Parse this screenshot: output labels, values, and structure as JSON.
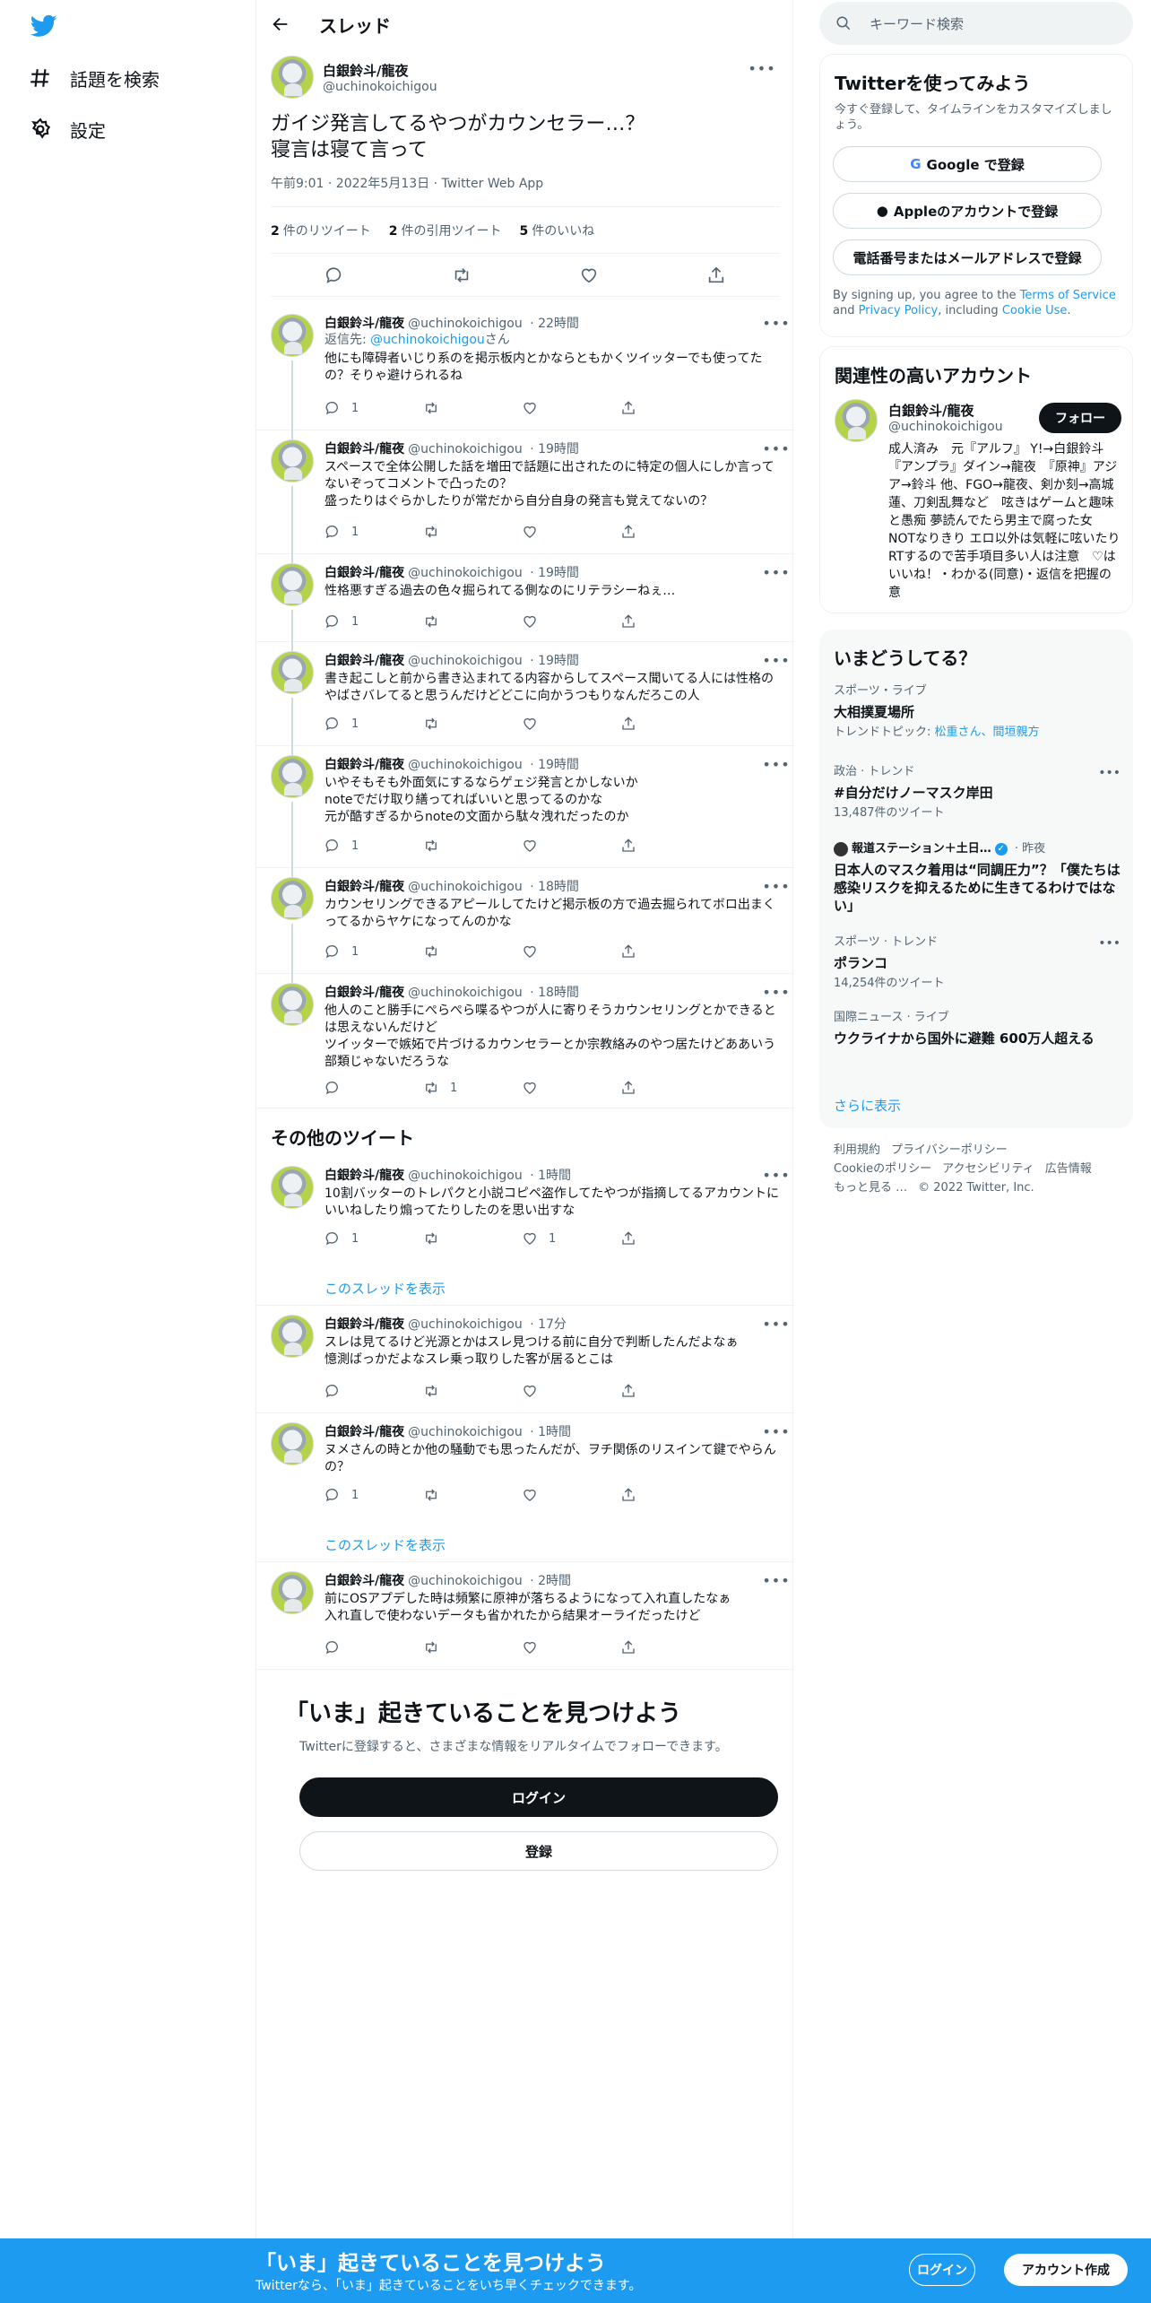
{
  "nav": {
    "explore_label": "話題を検索",
    "settings_label": "設定"
  },
  "header": {
    "title": "スレッド"
  },
  "main_tweet": {
    "name": "白銀鈴斗/龍夜",
    "handle": "@uchinokoichigou",
    "text": "ガイジ発言してるやつがカウンセラー…？\n寝言は寝て言って",
    "timestamp": "午前9:01 · 2022年5月13日 · Twitter Web App",
    "retweets_count": "2",
    "retweets_label": "件のリツイート",
    "quotes_count": "2",
    "quotes_label": "件の引用ツイート",
    "likes_count": "5",
    "likes_label": "件のいいね"
  },
  "replies": [
    {
      "name": "白銀鈴斗/龍夜",
      "handle": "@uchinokoichigou",
      "time": "· 22時間",
      "reply_prefix": "返信先: ",
      "reply_handle": "@uchinokoichigou",
      "reply_suffix": "さん",
      "text": "他にも障碍者いじり系のを掲示板内とかならともかくツイッターでも使ってたの？そりゃ避けられるね",
      "reply_count": "1",
      "rt_count": "",
      "like_count": ""
    },
    {
      "name": "白銀鈴斗/龍夜",
      "handle": "@uchinokoichigou",
      "time": "· 19時間",
      "text": "スペースで全体公開した話を増田で話題に出されたのに特定の個人にしか言ってないぞってコメントで凸ったの？\n盛ったりはぐらかしたりが常だから自分自身の発言も覚えてないの？",
      "reply_count": "1",
      "rt_count": "",
      "like_count": ""
    },
    {
      "name": "白銀鈴斗/龍夜",
      "handle": "@uchinokoichigou",
      "time": "· 19時間",
      "text": "性格悪すぎる過去の色々掘られてる側なのにリテラシーねぇ…",
      "reply_count": "1",
      "rt_count": "",
      "like_count": ""
    },
    {
      "name": "白銀鈴斗/龍夜",
      "handle": "@uchinokoichigou",
      "time": "· 19時間",
      "text": "書き起こしと前から書き込まれてる内容からしてスペース聞いてる人には性格のやばさバレてると思うんだけどどこに向かうつもりなんだろこの人",
      "reply_count": "1",
      "rt_count": "",
      "like_count": ""
    },
    {
      "name": "白銀鈴斗/龍夜",
      "handle": "@uchinokoichigou",
      "time": "· 19時間",
      "text": "いやそもそも外面気にするならゲェジ発言とかしないか\nnoteでだけ取り繕ってればいいと思ってるのかな\n元が酷すぎるからnoteの文面から駄々洩れだったのか",
      "reply_count": "1",
      "rt_count": "",
      "like_count": ""
    },
    {
      "name": "白銀鈴斗/龍夜",
      "handle": "@uchinokoichigou",
      "time": "· 18時間",
      "text": "カウンセリングできるアピールしてたけど掲示板の方で過去掘られてボロ出まくってるからヤケになってんのかな",
      "reply_count": "1",
      "rt_count": "",
      "like_count": ""
    },
    {
      "name": "白銀鈴斗/龍夜",
      "handle": "@uchinokoichigou",
      "time": "· 18時間",
      "text": "他人のこと勝手にぺらぺら喋るやつが人に寄りそうカウンセリングとかできるとは思えないんだけど\nツイッターで嫉妬で片づけるカウンセラーとか宗教絡みのやつ居たけどああいう部類じゃないだろうな",
      "reply_count": "",
      "rt_count": "1",
      "like_count": ""
    }
  ],
  "other_tweets_title": "その他のツイート",
  "other_tweets": [
    {
      "name": "白銀鈴斗/龍夜",
      "handle": "@uchinokoichigou",
      "time": "· 1時間",
      "text": "10割バッターのトレパクと小説コピペ盗作してたやつが指摘してるアカウントにいいねしたり煽ってたりしたのを思い出すな",
      "reply_count": "1",
      "rt_count": "",
      "like_count": "1",
      "show_thread": "このスレッドを表示"
    },
    {
      "name": "白銀鈴斗/龍夜",
      "handle": "@uchinokoichigou",
      "time": "· 17分",
      "text": "スレは見てるけど光源とかはスレ見つける前に自分で判断したんだよなぁ\n憶測ばっかだよなスレ乗っ取りした客が居るとこは",
      "reply_count": "",
      "rt_count": "",
      "like_count": ""
    },
    {
      "name": "白銀鈴斗/龍夜",
      "handle": "@uchinokoichigou",
      "time": "· 1時間",
      "text": "ヌメさんの時とか他の騒動でも思ったんだが、ヲチ関係のリスインて鍵でやらんの？",
      "reply_count": "1",
      "rt_count": "",
      "like_count": "",
      "show_thread": "このスレッドを表示"
    },
    {
      "name": "白銀鈴斗/龍夜",
      "handle": "@uchinokoichigou",
      "time": "· 2時間",
      "text": "前にOSアプデした時は頻繁に原神が落ちるようになって入れ直したなぁ\n入れ直しで使わないデータも省かれたから結果オーライだったけど",
      "reply_count": "",
      "rt_count": "",
      "like_count": ""
    }
  ],
  "cta": {
    "title": "「いま」起きていることを見つけよう",
    "subtitle": "Twitterに登録すると、さまざまな情報をリアルタイムでフォローできます。",
    "login_label": "ログイン",
    "signup_label": "登録"
  },
  "search": {
    "placeholder": "キーワード検索"
  },
  "signup_card": {
    "title": "Twitterを使ってみよう",
    "subtitle": "今すぐ登録して、タイムラインをカスタマイズしましょう。",
    "google_label": "Google で登録",
    "apple_label": "Appleのアカウントで登録",
    "phone_label": "電話番号またはメールアドレスで登録",
    "terms_prefix": "By signing up, you agree to the ",
    "terms_link": "Terms of Service",
    "terms_and": " and ",
    "privacy_link": "Privacy Policy",
    "terms_including": ", including ",
    "cookie_link": "Cookie Use",
    "terms_end": "."
  },
  "relevant": {
    "title": "関連性の高いアカウント",
    "name": "白銀鈴斗/龍夜",
    "handle": "@uchinokoichigou",
    "follow_label": "フォロー",
    "bio": "成人済み　元『アルフ』 Y!→白銀鈴斗『アンプラ』ダイン→龍夜　『原神』アジア→鈴斗 他、FGO→龍夜、剣か刻→高城蓮、刀剣乱舞など　呟きはゲームと趣味と愚痴 夢読んでたら男主で腐った女　NOTなりきり エロ以外は気軽に呟いたりRTするので苦手項目多い人は注意　♡はいいね！・わかる(同意)・返信を把握の意"
  },
  "trends": {
    "title": "いまどうしてる？",
    "items": [
      {
        "category": "スポーツ・ライブ",
        "topic": "大相撲夏場所",
        "sub_prefix": "トレンドトピック: ",
        "sub_links": "松重さん、間垣親方"
      },
      {
        "category": "政治 · トレンド",
        "topic": "#自分だけノーマスク岸田",
        "count": "13,487件のツイート"
      },
      {
        "category": "報道ステーション＋土日…",
        "category_suffix": " · 昨夜",
        "topic": "日本人のマスク着用は“同調圧力”？「僕たちは感染リスクを抑えるために生きてるわけではない」"
      },
      {
        "category": "スポーツ · トレンド",
        "topic": "ポランコ",
        "count": "14,254件のツイート"
      },
      {
        "category": "国際ニュース · ライブ",
        "topic": "ウクライナから国外に避難 600万人超える"
      }
    ],
    "show_more": "さらに表示"
  },
  "footer": {
    "terms": "利用規約",
    "privacy": "プライバシーポリシー",
    "cookie": "Cookieのポリシー",
    "accessibility": "アクセシビリティ",
    "ads": "広告情報",
    "more": "もっと見る …",
    "copyright": "© 2022 Twitter, Inc."
  },
  "bottom_bar": {
    "title": "「いま」起きていることを見つけよう",
    "subtitle": "Twitterなら、「いま」起きていることをいち早くチェックできます。",
    "login_label": "ログイン",
    "signup_label": "アカウント作成"
  },
  "colors": {
    "accent": "#1d9bf0",
    "text": "#0f1419",
    "secondary": "#536471"
  }
}
